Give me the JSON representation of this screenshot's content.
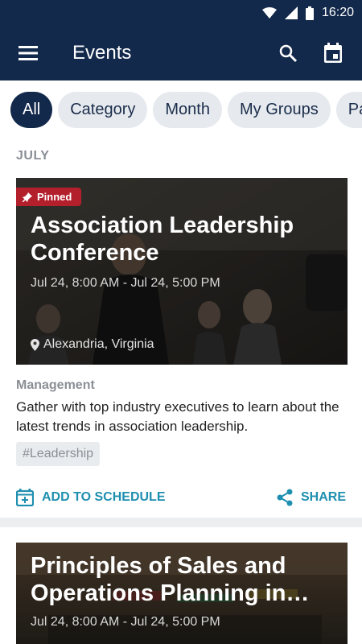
{
  "status_bar": {
    "time": "16:20"
  },
  "app_bar": {
    "title": "Events",
    "icons": [
      "menu-icon",
      "search-icon",
      "calendar-icon"
    ]
  },
  "filters": [
    "All",
    "Category",
    "Month",
    "My Groups",
    "Pa"
  ],
  "section": {
    "label": "JULY"
  },
  "events": [
    {
      "pinned_label": "Pinned",
      "title": "Association Leadership Conference",
      "date": "Jul 24, 8:00 AM - Jul 24, 5:00 PM",
      "location": "Alexandria, Virginia",
      "category": "Management",
      "description": "Gather with top industry executives to learn about the latest trends in association leadership.",
      "tag": "#Leadership",
      "add_label": "ADD TO SCHEDULE",
      "share_label": "SHARE"
    },
    {
      "title": "Principles of Sales and Operations Planning in big…",
      "date": "Jul 24, 8:00 AM - Jul 24, 5:00 PM"
    }
  ],
  "colors": {
    "header": "#13294b",
    "accent": "#1f8fb0",
    "pinned": "#b3202c"
  }
}
